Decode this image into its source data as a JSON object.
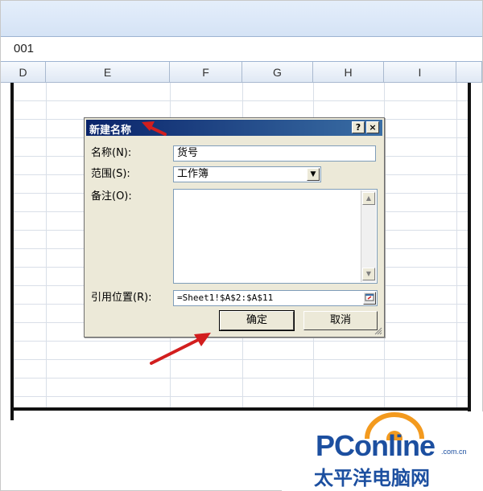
{
  "formula_bar": {
    "value": "001"
  },
  "columns": [
    "D",
    "E",
    "F",
    "G",
    "H",
    "I"
  ],
  "dialog": {
    "title": "新建名称",
    "help_button": "?",
    "close_button": "×",
    "name_label": "名称(N):",
    "name_value": "货号",
    "scope_label": "范围(S):",
    "scope_value": "工作簿",
    "comment_label": "备注(O):",
    "comment_value": "",
    "refers_label": "引用位置(R):",
    "refers_value": "=Sheet1!$A$2:$A$11",
    "ok_label": "确定",
    "cancel_label": "取消"
  },
  "watermark": {
    "brand": "PConline",
    "domain": ".com.cn",
    "chinese": "太平洋电脑网"
  },
  "colors": {
    "titlebar": "#0a246a",
    "arrow": "#d21e1e",
    "logo": "#1c4fa0",
    "logo_accent": "#f39a1e"
  }
}
